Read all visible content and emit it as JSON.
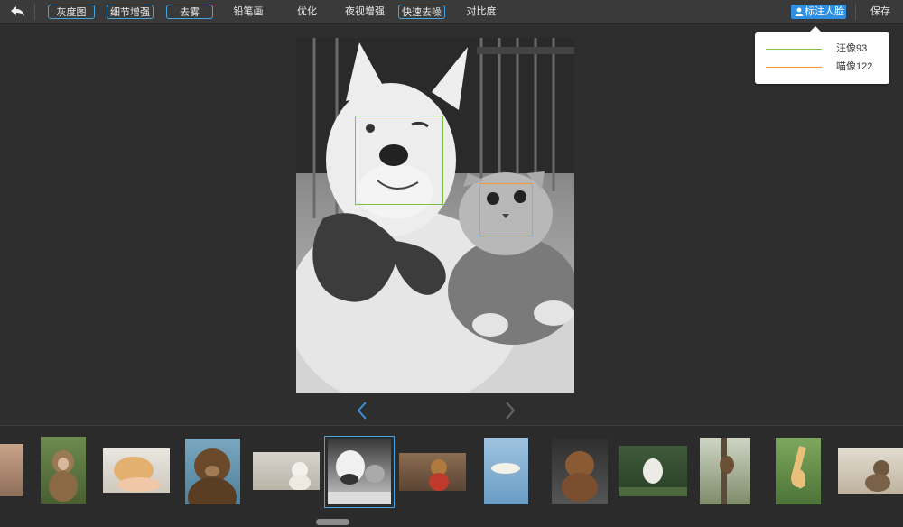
{
  "toolbar": {
    "filters": [
      {
        "label": "灰度图",
        "active": true
      },
      {
        "label": "细节增强",
        "active": true
      },
      {
        "label": "去雾",
        "active": true
      },
      {
        "label": "铅笔画",
        "active": false
      },
      {
        "label": "优化",
        "active": false
      },
      {
        "label": "夜视增强",
        "active": false
      },
      {
        "label": "快速去噪",
        "active": true
      },
      {
        "label": "对比度",
        "active": false
      }
    ],
    "annotate_label": "标注人脸",
    "save_label": "保存"
  },
  "legend": {
    "items": [
      {
        "label": "汪像93",
        "color": "#7cc24a"
      },
      {
        "label": "喵像122",
        "color": "#f0962e"
      }
    ]
  },
  "photo": {
    "subject": "grayscale photo of white dog with bow tie and cat",
    "faces": [
      {
        "label": "汪像93",
        "color": "#7cc24a"
      },
      {
        "label": "喵像122",
        "color": "#f0962e"
      }
    ]
  },
  "thumbnails": {
    "selected_index": 5,
    "items": [
      "partial-face",
      "monkey",
      "hamster",
      "bear",
      "cat-on-bed",
      "dog-and-cat",
      "teddy-bear-shop",
      "polar-bear",
      "bear-cub",
      "white-bear-forest",
      "monkey-in-tree",
      "gibbon",
      "monkey-sitting"
    ]
  },
  "colors": {
    "accent": "#2f8fe0",
    "selection": "#4aa3df",
    "dog_box": "#7cc24a",
    "cat_box": "#f0962e"
  }
}
